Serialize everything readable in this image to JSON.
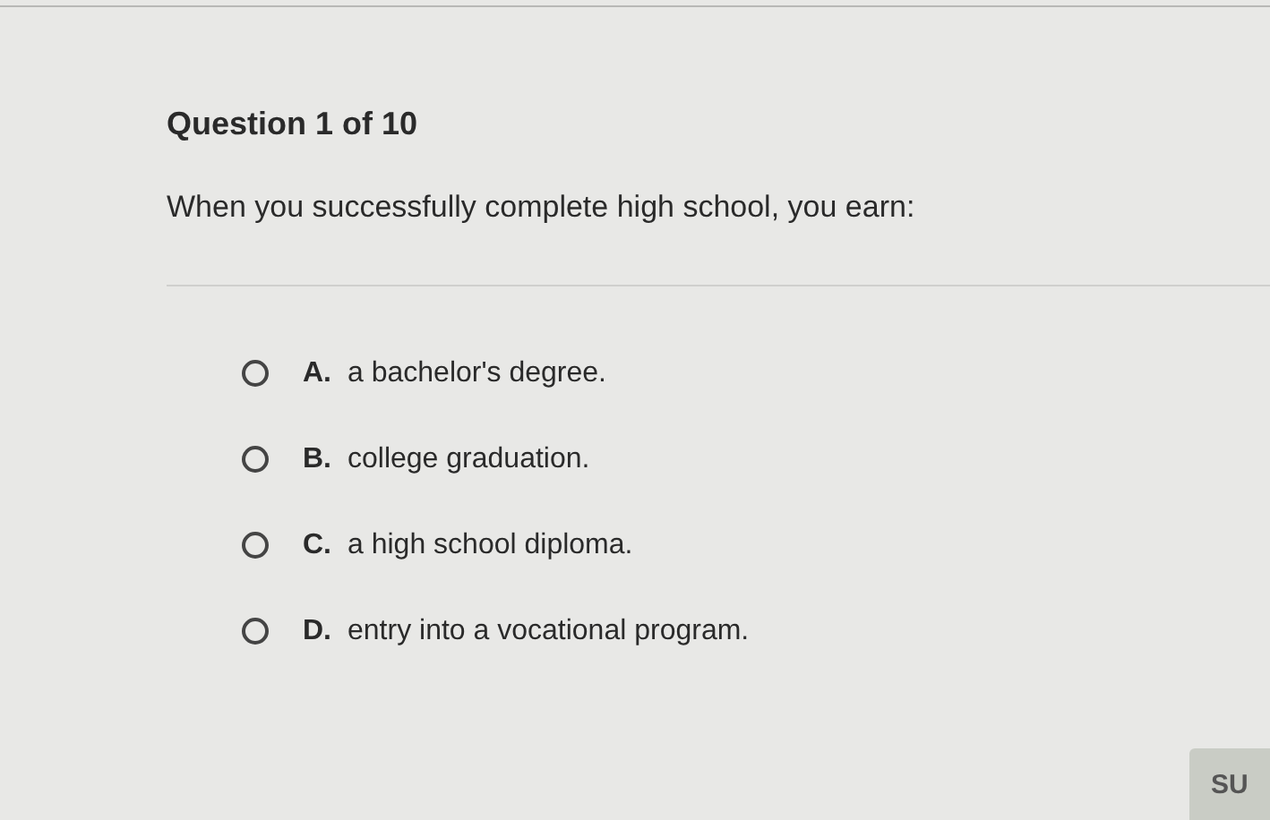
{
  "question": {
    "title": "Question 1 of 10",
    "prompt": "When you successfully complete high school, you earn:"
  },
  "options": [
    {
      "letter": "A.",
      "text": "a bachelor's degree.",
      "selected": false
    },
    {
      "letter": "B.",
      "text": "college graduation.",
      "selected": false
    },
    {
      "letter": "C.",
      "text": "a high school diploma.",
      "selected": false
    },
    {
      "letter": "D.",
      "text": "entry into a vocational program.",
      "selected": false
    }
  ],
  "submit_button": {
    "label": "SU"
  }
}
